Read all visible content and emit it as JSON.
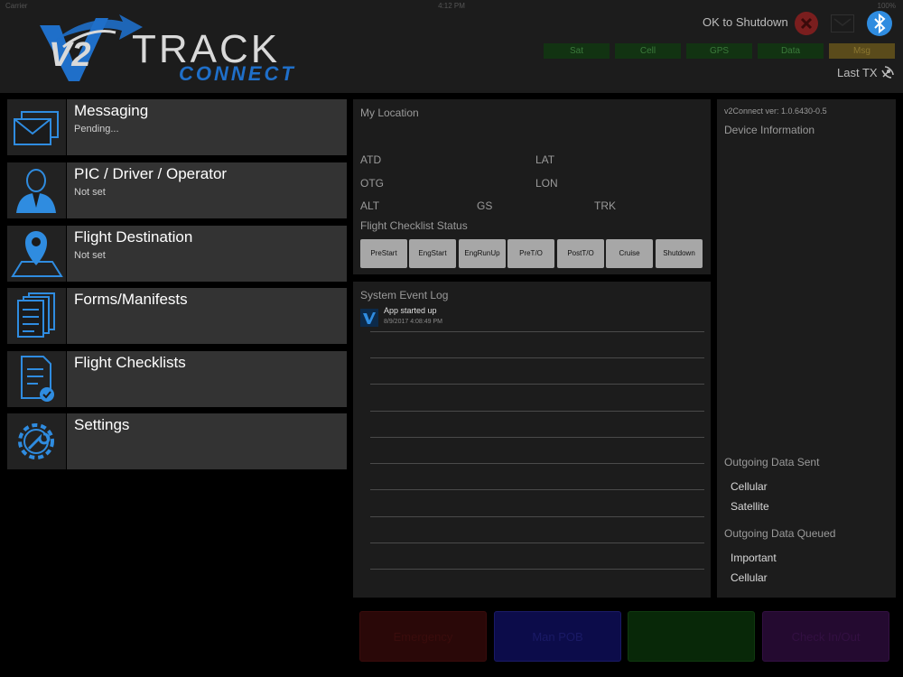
{
  "status_bar": {
    "carrier": "Carrier",
    "time": "4:12 PM",
    "battery": "100%"
  },
  "header": {
    "logo_v2": "V2",
    "logo_track": "TRACK",
    "logo_connect": "CONNECT",
    "shutdown_label": "OK to Shutdown",
    "status_indicators": [
      "Sat",
      "Cell",
      "GPS",
      "Data",
      "Msg"
    ],
    "last_tx_label": "Last TX"
  },
  "menu": [
    {
      "title": "Messaging",
      "subtitle": "Pending...",
      "icon": "envelope-icon"
    },
    {
      "title": "PIC / Driver / Operator",
      "subtitle": "Not set",
      "icon": "person-icon"
    },
    {
      "title": "Flight Destination",
      "subtitle": "Not set",
      "icon": "map-pin-icon"
    },
    {
      "title": "Forms/Manifests",
      "subtitle": "",
      "icon": "forms-icon"
    },
    {
      "title": "Flight Checklists",
      "subtitle": "",
      "icon": "checklist-icon"
    },
    {
      "title": "Settings",
      "subtitle": "",
      "icon": "settings-icon"
    }
  ],
  "location": {
    "title": "My Location",
    "atd": "ATD",
    "lat": "LAT",
    "otg": "OTG",
    "lon": "LON",
    "alt": "ALT",
    "gs": "GS",
    "trk": "TRK",
    "checklist_title": "Flight Checklist Status",
    "checklist_buttons": [
      "PreStart",
      "EngStart",
      "EngRunUp",
      "PreT/O",
      "PostT/O",
      "Cruise",
      "Shutdown"
    ]
  },
  "event_log": {
    "title": "System Event Log",
    "entries": [
      {
        "message": "App started up",
        "timestamp": "8/9/2017 4:08:49 PM"
      }
    ]
  },
  "device_info": {
    "version": "v2Connect ver: 1.0.6430-0.5",
    "title": "Device Information",
    "sent_title": "Outgoing Data Sent",
    "sent_items": [
      "Cellular",
      "Satellite"
    ],
    "queued_title": "Outgoing Data Queued",
    "queued_items": [
      "Important",
      "Cellular"
    ]
  },
  "bottom_buttons": [
    "Emergency",
    "Man POB",
    "",
    "Check In/Out"
  ],
  "colors": {
    "accent_blue": "#2f8ce0",
    "logo_blue": "#1f6fc9",
    "status_green": "#123312",
    "status_warn": "#5a4b1b",
    "close_red": "#7a1e1e",
    "btn_red": "#4a0d0d",
    "btn_blue": "#14147a",
    "btn_green": "#0e3a0e",
    "btn_purple": "#3a1248"
  }
}
